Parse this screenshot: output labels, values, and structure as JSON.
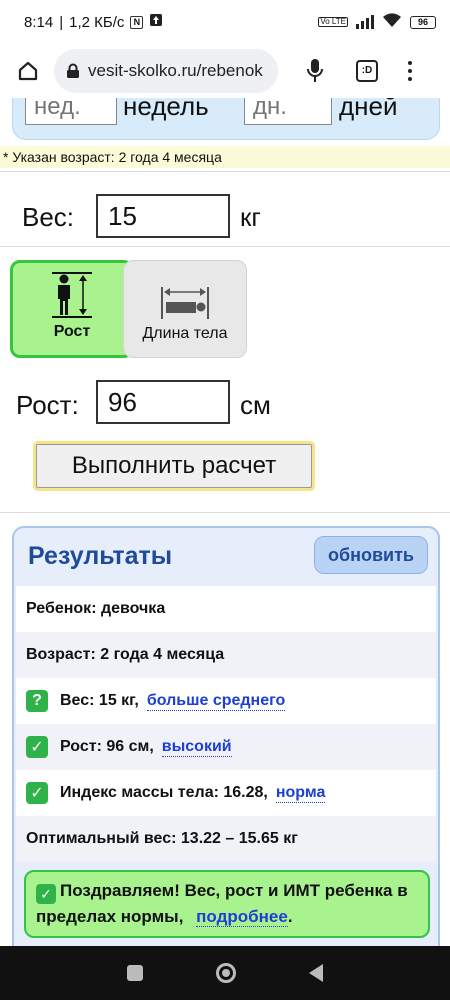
{
  "status_bar": {
    "time": "8:14",
    "speed": "1,2 КБ/с",
    "nfc_icon": "N",
    "volte": "Vo LTE",
    "battery": "96"
  },
  "browser": {
    "url": "vesit-skolko.ru/rebenok",
    "tab_icon": ":D"
  },
  "age": {
    "weeks_placeholder": "нед.",
    "weeks_word": "недель",
    "days_placeholder": "дн.",
    "days_word": "дней",
    "note": "* Указан возраст: 2 года 4 месяца"
  },
  "weight": {
    "label": "Вес:",
    "value": "15",
    "unit": "кг"
  },
  "modes": {
    "height_label": "Рост",
    "length_label": "Длина тела"
  },
  "height": {
    "label": "Рост:",
    "value": "96",
    "unit": "см"
  },
  "calc_button": "Выполнить расчет",
  "results": {
    "title": "Результаты",
    "refresh": "обновить",
    "child": "Ребенок: девочка",
    "age": "Возраст: 2 года 4 месяца",
    "weight_text": "Вес: 15 кг,",
    "weight_link": "больше среднего",
    "weight_icon": "?",
    "height_text": "Рост: 96 см,",
    "height_link": "высокий",
    "bmi_text": "Индекс массы тела: 16.28,",
    "bmi_link": "норма",
    "optimal": "Оптимальный вес: 13.22 – 15.65 кг",
    "congrats_text": "Поздравляем! Вес, рост и ИМТ ребенка в пределах нормы,",
    "congrats_link": "подробнее",
    "congrats_end": "."
  },
  "colors": {
    "accent_green": "#37c53e",
    "result_title": "#1f4b99",
    "link": "#1d3fd6"
  }
}
